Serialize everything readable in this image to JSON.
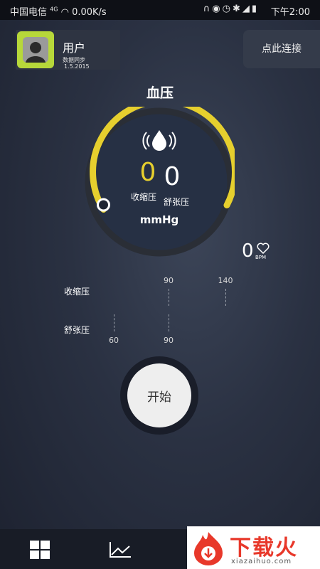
{
  "status_bar": {
    "carrier": "中国电信",
    "network": "4G",
    "speed": "0.00K/s",
    "time": "下午2:00",
    "icons": [
      "headphones-icon",
      "eye-icon",
      "alarm-icon",
      "bluetooth-icon",
      "signal-icon",
      "battery-icon"
    ]
  },
  "user": {
    "name": "用户",
    "sync_label": "数据同步",
    "sync_date": "1.5.2015",
    "avatar_color": "#b7d83a"
  },
  "connect_label": "点此连接",
  "title": "血压",
  "gauge": {
    "systolic_value": "0",
    "diastolic_value": "0",
    "systolic_label": "收缩压",
    "diastolic_label": "舒张压",
    "unit": "mmHg",
    "accent_color": "#e6cf2e",
    "value_color": "#e6cf2e"
  },
  "heart_rate": {
    "value": "0",
    "unit": "BPM"
  },
  "scales": {
    "systolic": {
      "label": "收缩压",
      "ticks": [
        "90",
        "140"
      ]
    },
    "diastolic": {
      "label": "舒张压",
      "ticks": [
        "60",
        "90"
      ]
    }
  },
  "start_label": "开始",
  "bottom_nav": {
    "items": [
      "grid-icon",
      "chart-line-icon",
      "download-icon"
    ]
  },
  "watermark": {
    "text": "下载火",
    "url": "xiazaihuo.com",
    "color": "#e8382a"
  }
}
